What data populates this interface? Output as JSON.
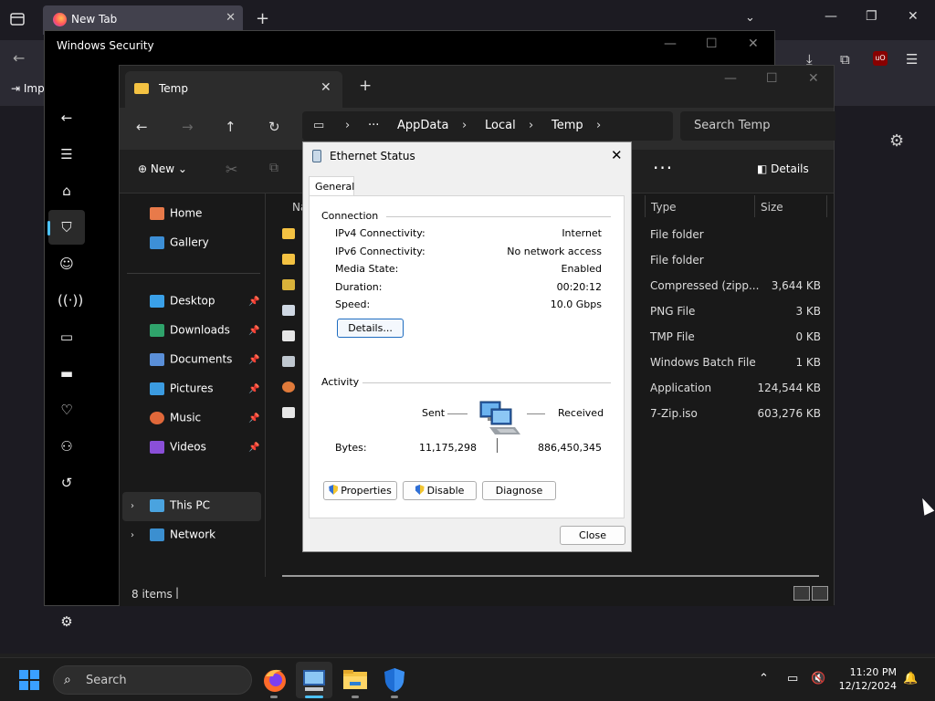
{
  "firefox": {
    "tab_title": "New Tab",
    "import_label": "Imp",
    "new_tab_symbol": "+",
    "ublock_label": "uO"
  },
  "windows_security": {
    "title": "Windows Security"
  },
  "explorer": {
    "tab_title": "Temp",
    "breadcrumb": [
      "AppData",
      "Local",
      "Temp"
    ],
    "search_placeholder": "Search Temp",
    "new_label": "New",
    "details_label": "Details",
    "list_header": {
      "name": "Na",
      "type": "Type",
      "size": "Size"
    },
    "sidebar": {
      "home": "Home",
      "gallery": "Gallery",
      "desktop": "Desktop",
      "downloads": "Downloads",
      "documents": "Documents",
      "pictures": "Pictures",
      "music": "Music",
      "videos": "Videos",
      "this_pc": "This PC",
      "network": "Network"
    },
    "rows": [
      {
        "type": "File folder",
        "size": ""
      },
      {
        "type": "File folder",
        "size": ""
      },
      {
        "type": "Compressed (zipp...",
        "size": "3,644 KB"
      },
      {
        "type": "PNG File",
        "size": "3 KB"
      },
      {
        "type": "TMP File",
        "size": "0 KB"
      },
      {
        "type": "Windows Batch File",
        "size": "1 KB"
      },
      {
        "type": "Application",
        "size": "124,544 KB"
      },
      {
        "type": "7-Zip.iso",
        "size": "603,276 KB"
      }
    ],
    "status": "8 items"
  },
  "dialog": {
    "title": "Ethernet Status",
    "tab": "General",
    "connection_label": "Connection",
    "connection": [
      {
        "key": "IPv4 Connectivity:",
        "value": "Internet"
      },
      {
        "key": "IPv6 Connectivity:",
        "value": "No network access"
      },
      {
        "key": "Media State:",
        "value": "Enabled"
      },
      {
        "key": "Duration:",
        "value": "00:20:12"
      },
      {
        "key": "Speed:",
        "value": "10.0 Gbps"
      }
    ],
    "details_button": "Details...",
    "activity_label": "Activity",
    "sent_label": "Sent",
    "received_label": "Received",
    "bytes_label": "Bytes:",
    "bytes_sent": "11,175,298",
    "bytes_received": "886,450,345",
    "properties_button": "Properties",
    "disable_button": "Disable",
    "diagnose_button": "Diagnose",
    "close_button": "Close"
  },
  "taskbar": {
    "search_placeholder": "Search",
    "time": "11:20 PM",
    "date": "12/12/2024"
  },
  "colors": {
    "accent": "#4cc2ff",
    "dialog_bg": "#f0f0f0",
    "folder": "#f4c242"
  }
}
